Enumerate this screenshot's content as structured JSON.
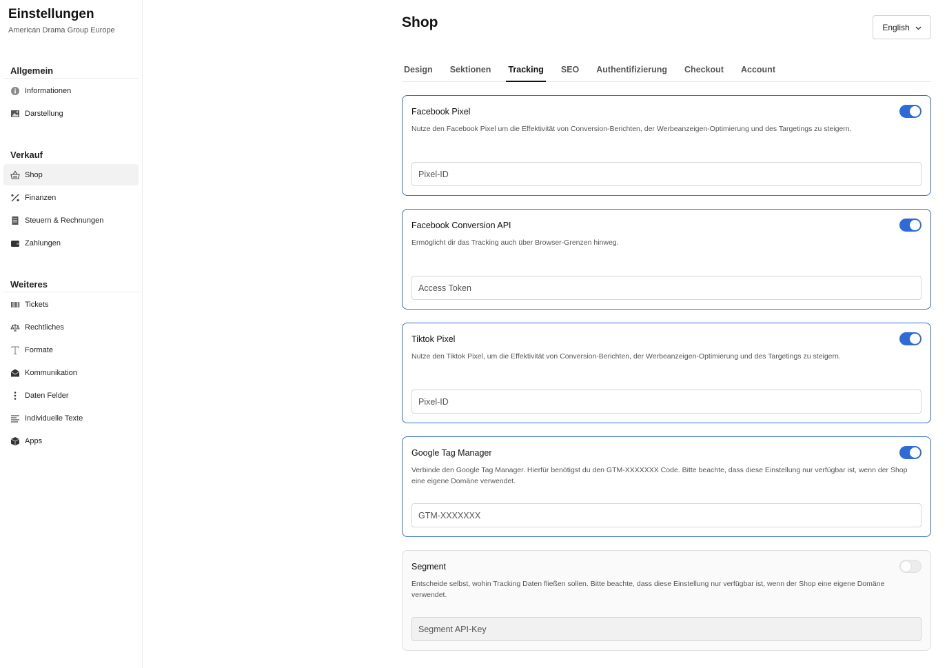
{
  "sidebar": {
    "title": "Einstellungen",
    "subtitle": "American Drama Group Europe",
    "sections": [
      {
        "heading": "Allgemein",
        "items": [
          {
            "label": "Informationen",
            "icon": "info-icon"
          },
          {
            "label": "Darstellung",
            "icon": "image-icon"
          }
        ]
      },
      {
        "heading": "Verkauf",
        "items": [
          {
            "label": "Shop",
            "icon": "basket-icon"
          },
          {
            "label": "Finanzen",
            "icon": "percent-icon"
          },
          {
            "label": "Steuern & Rechnungen",
            "icon": "receipt-icon"
          },
          {
            "label": "Zahlungen",
            "icon": "wallet-icon"
          }
        ]
      },
      {
        "heading": "Weiteres",
        "items": [
          {
            "label": "Tickets",
            "icon": "barcode-icon"
          },
          {
            "label": "Rechtliches",
            "icon": "scale-icon"
          },
          {
            "label": "Formate",
            "icon": "text-icon"
          },
          {
            "label": "Kommunikation",
            "icon": "mail-icon"
          },
          {
            "label": "Daten Felder",
            "icon": "dots-vertical-icon"
          },
          {
            "label": "Individuelle Texte",
            "icon": "lines-icon"
          },
          {
            "label": "Apps",
            "icon": "cube-icon"
          }
        ]
      }
    ]
  },
  "header": {
    "title": "Shop",
    "language": "English"
  },
  "tabs": [
    "Design",
    "Sektionen",
    "Tracking",
    "SEO",
    "Authentifizierung",
    "Checkout",
    "Account"
  ],
  "active_tab": "Tracking",
  "cards": [
    {
      "title": "Facebook Pixel",
      "description": "Nutze den Facebook Pixel um die Effektivität von Conversion-Berichten, der Werbeanzeigen-Optimierung und des Targetings zu steigern.",
      "enabled": true,
      "placeholder": "Pixel-ID",
      "value": ""
    },
    {
      "title": "Facebook Conversion API",
      "description": "Ermöglicht dir das Tracking auch über Browser-Grenzen hinweg.",
      "enabled": true,
      "placeholder": "Access Token",
      "value": ""
    },
    {
      "title": "Tiktok Pixel",
      "description": "Nutze den Tiktok Pixel, um die Effektivität von Conversion-Berichten, der Werbeanzeigen-Optimierung und des Targetings zu steigern.",
      "enabled": true,
      "placeholder": "Pixel-ID",
      "value": ""
    },
    {
      "title": "Google Tag Manager",
      "description": "Verbinde den Google Tag Manager. Hierfür benötigst du den GTM-XXXXXXX Code. Bitte beachte, dass diese Einstellung nur verfügbar ist, wenn der Shop eine eigene Domäne verwendet.",
      "enabled": true,
      "placeholder": "GTM-XXXXXXX",
      "value": ""
    },
    {
      "title": "Segment",
      "description": "Entscheide selbst, wohin Tracking Daten fließen sollen. Bitte beachte, dass diese Einstellung nur verfügbar ist, wenn der Shop eine eigene Domäne verwendet.",
      "enabled": false,
      "placeholder": "Segment API-Key",
      "value": ""
    }
  ],
  "colors": {
    "accent": "#2f6bd8",
    "active_nav_bg": "#f2f2f2",
    "border": "#dedede"
  }
}
